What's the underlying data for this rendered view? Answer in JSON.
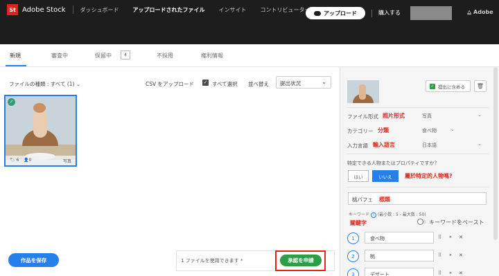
{
  "topnav": {
    "logo": "St",
    "brand": "Adobe Stock",
    "items": [
      "ダッシュボード",
      "アップロードされたファイル",
      "インサイト",
      "コントリビューターアカウント"
    ]
  },
  "subbar": {
    "upload_label": "アップロード",
    "buy_label": "購入する",
    "adobe_label": "Adobe"
  },
  "tabs": {
    "items": [
      "新規",
      "審査中",
      "保留中",
      "不採用",
      "権利情報"
    ],
    "pending_count": "4"
  },
  "toolbar": {
    "file_type_filter": "ファイルの種類 : すべて (1)",
    "csv_upload": "CSV をアップロード",
    "select_all": "すべて選択",
    "sort_label": "並べ替え",
    "sort_value": "提出状況"
  },
  "thumbnail": {
    "tag_count": "6",
    "people_count": "0",
    "type": "写真"
  },
  "bottom": {
    "save_label": "作品を保存",
    "files_available": "1 ファイルを使用できます *",
    "submit_label": "承認を申請"
  },
  "panel": {
    "include_label": "提出に含める",
    "file_type_label": "ファイル形式",
    "file_type_annot": "照片形式",
    "file_type_value": "写真",
    "category_label": "カテゴリー",
    "category_annot": "分類",
    "category_value": "食べ物",
    "language_label": "入力言語",
    "language_annot": "輸入語言",
    "language_value": "日本語",
    "question": "特定できる人物またはプロパティですか？",
    "yes_label": "はい",
    "no_label": "いいえ",
    "question_annot": "屬於特定的人物嗎?",
    "title_value": "桃パフェ",
    "title_annot": "標題",
    "keywords_label": "キーワード",
    "keywords_hint": "(最小数 : 5 - 最大数 : 50)",
    "keywords_annot": "關鍵字",
    "paste_label": "キーワードをペースト",
    "keywords": [
      {
        "num": "1",
        "text": "食べ物"
      },
      {
        "num": "2",
        "text": "桃"
      },
      {
        "num": "3",
        "text": "デザート"
      }
    ]
  },
  "colors": {
    "accent": "#2680eb",
    "submit": "#2d9d46",
    "annotation": "#e0261a",
    "nav_bg": "#1d1d1d"
  }
}
